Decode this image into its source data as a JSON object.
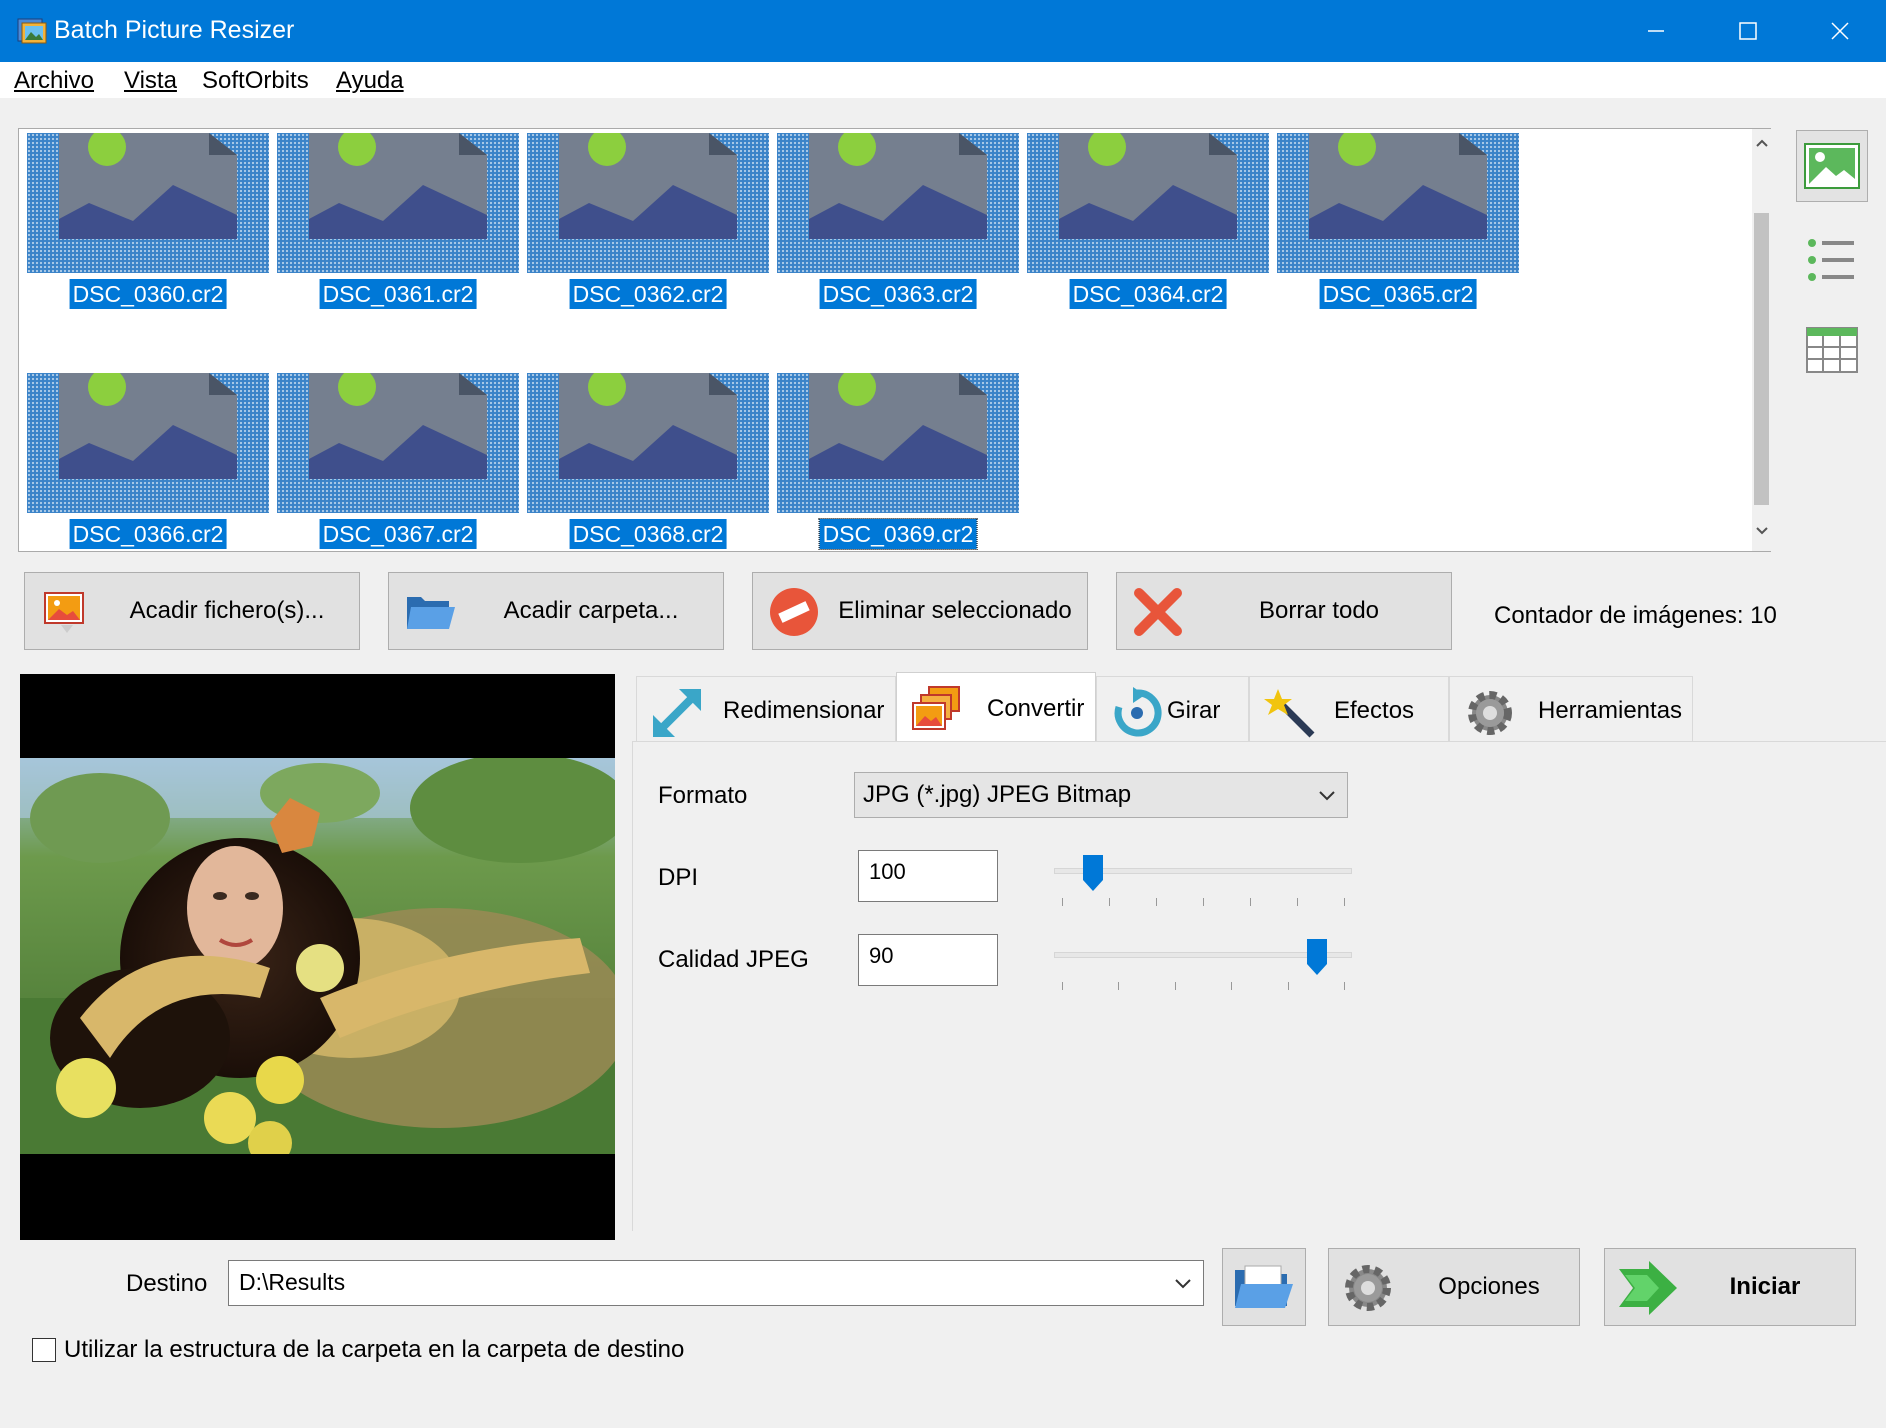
{
  "window": {
    "title": "Batch Picture Resizer"
  },
  "menu": {
    "items": [
      "Archivo",
      "Vista",
      "SoftOrbits",
      "Ayuda"
    ]
  },
  "thumbnails": [
    {
      "name": "DSC_0360.cr2"
    },
    {
      "name": "DSC_0361.cr2"
    },
    {
      "name": "DSC_0362.cr2"
    },
    {
      "name": "DSC_0363.cr2"
    },
    {
      "name": "DSC_0364.cr2"
    },
    {
      "name": "DSC_0365.cr2"
    },
    {
      "name": "DSC_0366.cr2"
    },
    {
      "name": "DSC_0367.cr2"
    },
    {
      "name": "DSC_0368.cr2"
    },
    {
      "name": "DSC_0369.cr2"
    }
  ],
  "actions": {
    "add_files": "Acadir fichero(s)...",
    "add_folder": "Acadir carpeta...",
    "remove_selected": "Eliminar seleccionado",
    "clear_all": "Borrar todo",
    "image_counter": "Contador de imágenes: 10"
  },
  "tabs": {
    "resize": "Redimensionar",
    "convert": "Convertir",
    "rotate": "Girar",
    "effects": "Efectos",
    "tools": "Herramientas",
    "active": "Convertir"
  },
  "convert": {
    "format_label": "Formato",
    "format_value": "JPG (*.jpg) JPEG Bitmap",
    "dpi_label": "DPI",
    "dpi_value": "100",
    "quality_label": "Calidad JPEG",
    "quality_value": "90"
  },
  "bottom": {
    "dest_label": "Destino",
    "dest_value": "D:\\Results",
    "options": "Opciones",
    "start": "Iniciar",
    "folder_structure": "Utilizar la estructura de la carpeta en la carpeta de destino",
    "folder_structure_checked": false
  },
  "colors": {
    "titlebar": "#0078d7",
    "selection": "#0078d7"
  }
}
